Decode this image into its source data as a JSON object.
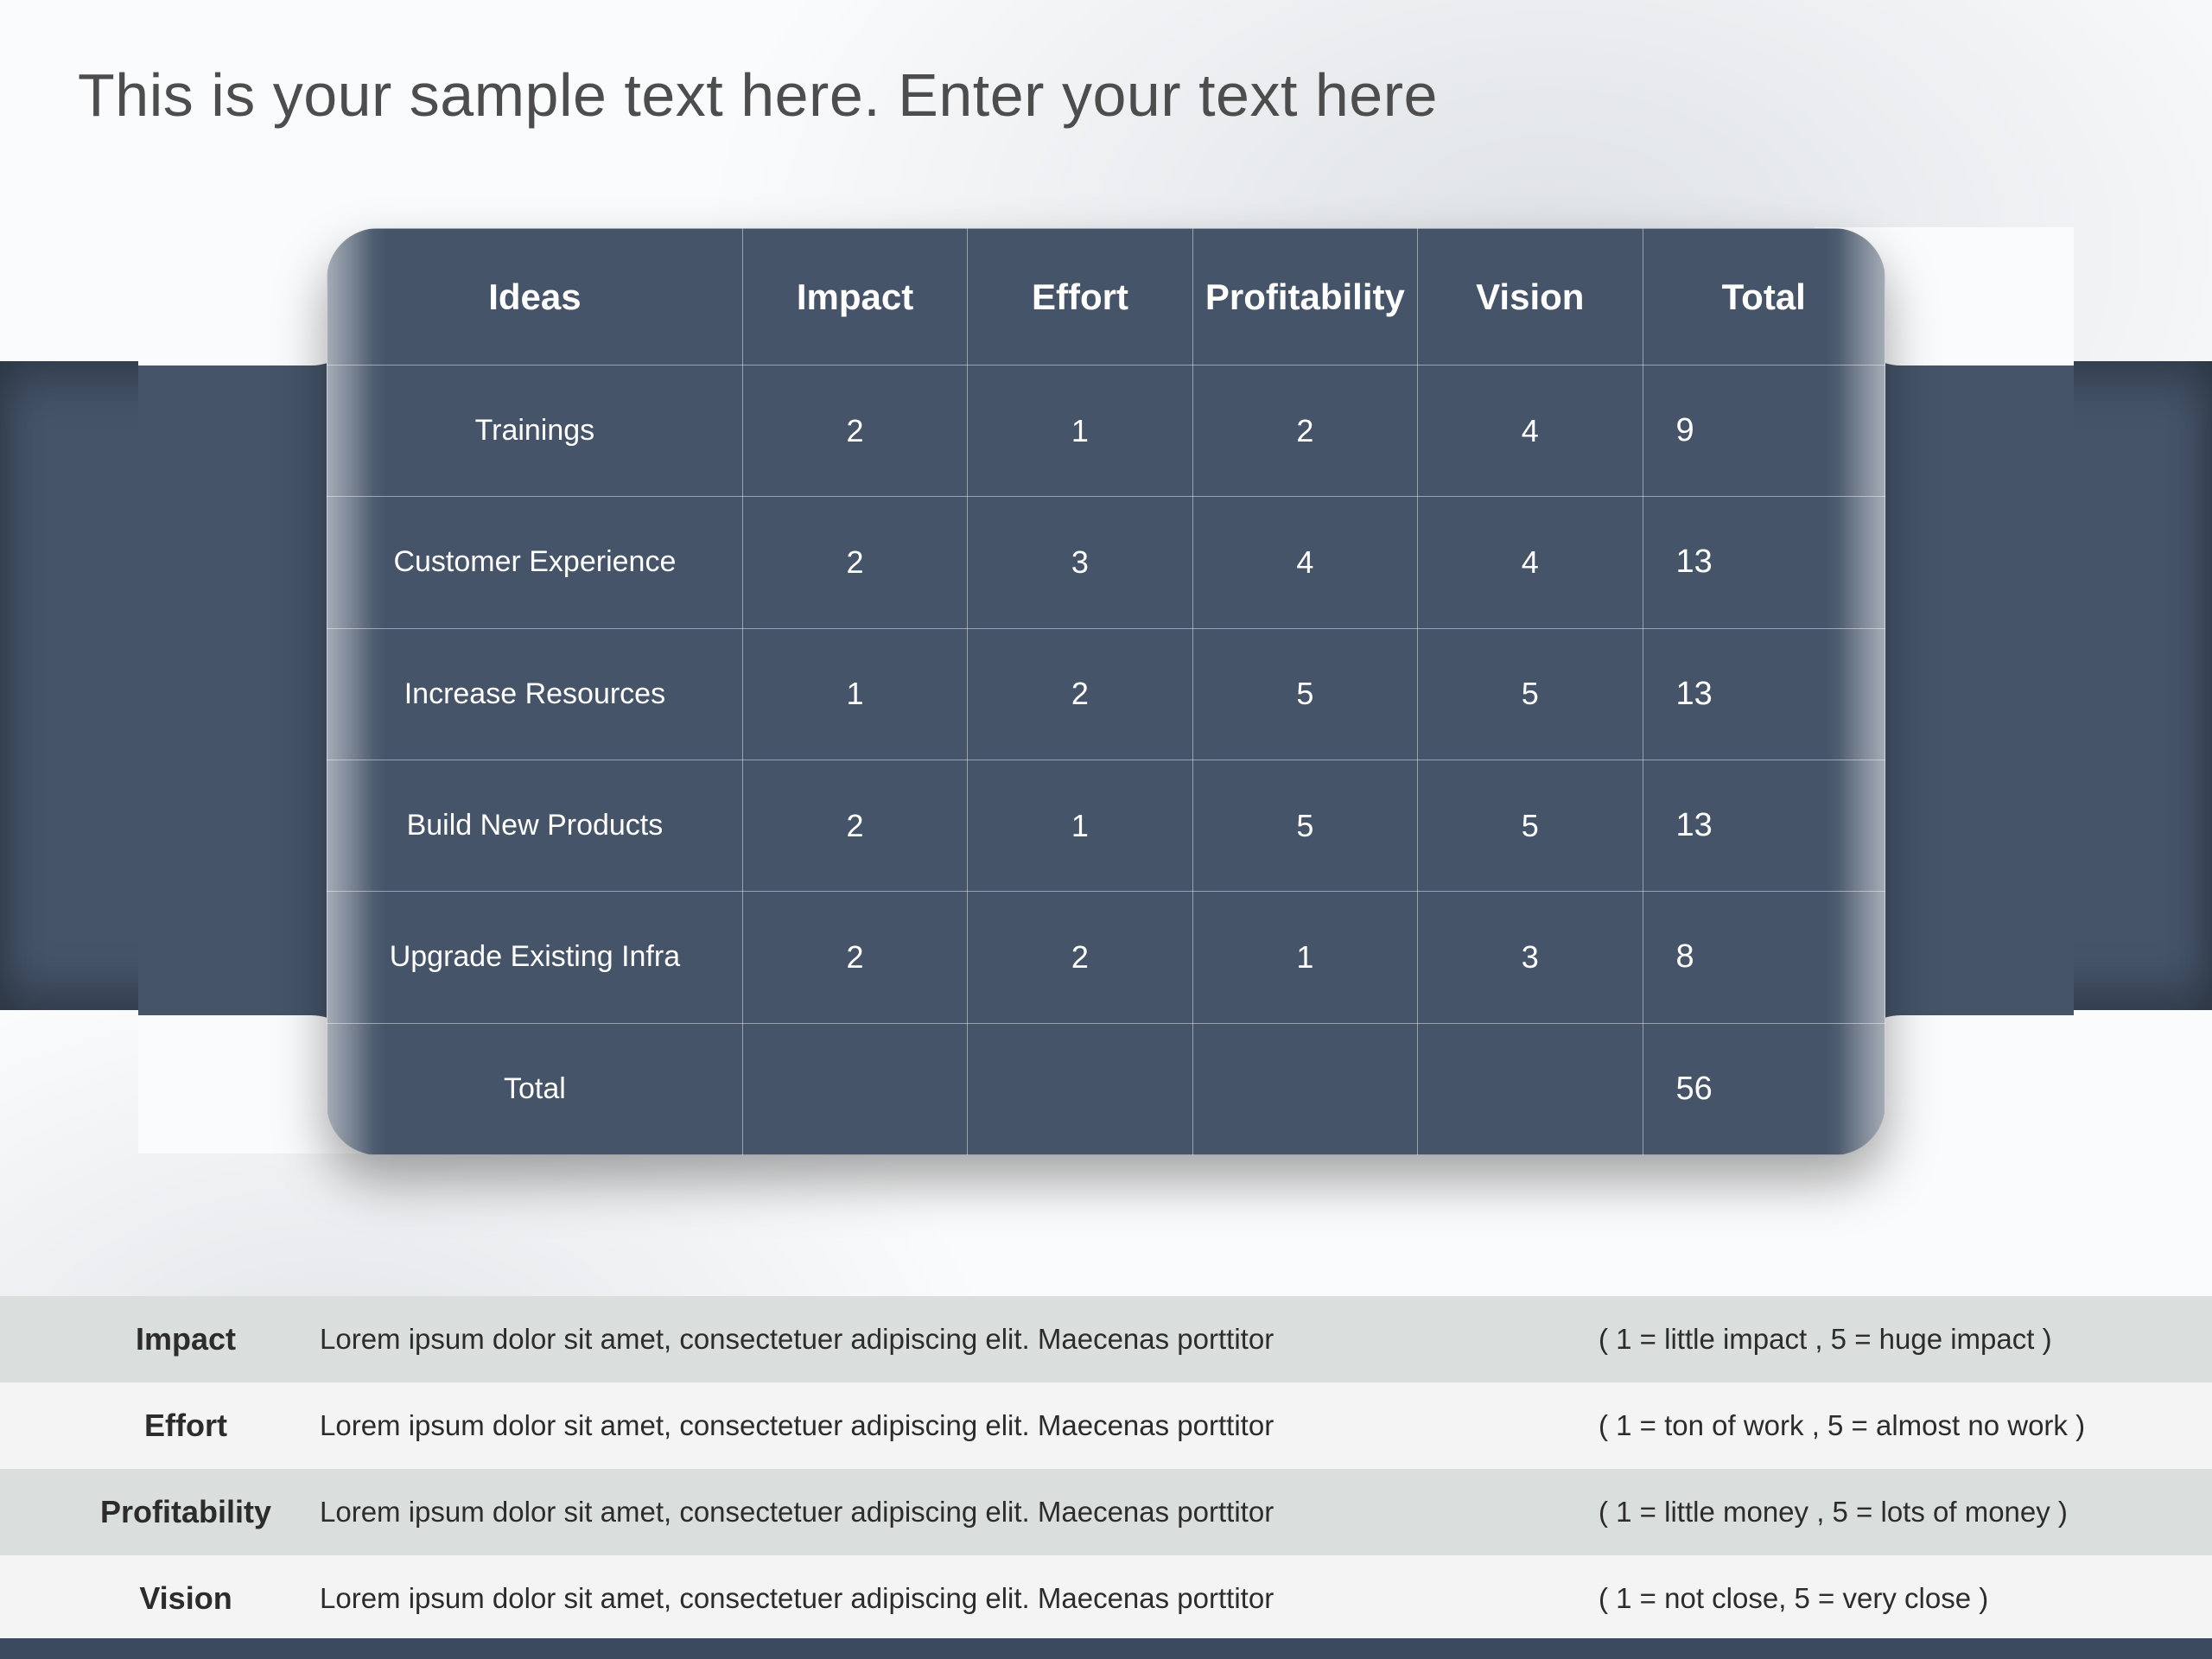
{
  "title": "This is your sample text here. Enter your text here",
  "table": {
    "headers": [
      "Ideas",
      "Impact",
      "Effort",
      "Profitability",
      "Vision",
      "Total"
    ],
    "rows": [
      {
        "idea": "Trainings",
        "impact": "2",
        "effort": "1",
        "profitability": "2",
        "vision": "4",
        "total": "9"
      },
      {
        "idea": "Customer Experience",
        "impact": "2",
        "effort": "3",
        "profitability": "4",
        "vision": "4",
        "total": "13"
      },
      {
        "idea": "Increase Resources",
        "impact": "1",
        "effort": "2",
        "profitability": "5",
        "vision": "5",
        "total": "13"
      },
      {
        "idea": "Build New Products",
        "impact": "2",
        "effort": "1",
        "profitability": "5",
        "vision": "5",
        "total": "13"
      },
      {
        "idea": "Upgrade Existing Infra",
        "impact": "2",
        "effort": "2",
        "profitability": "1",
        "vision": "3",
        "total": "8"
      }
    ],
    "footer": {
      "label": "Total",
      "total": "56"
    }
  },
  "legend": [
    {
      "label": "Impact",
      "desc": "Lorem ipsum dolor sit amet, consectetuer adipiscing elit. Maecenas porttitor",
      "scale": "( 1 = little impact , 5 = huge impact )"
    },
    {
      "label": "Effort",
      "desc": "Lorem ipsum dolor sit amet, consectetuer adipiscing elit. Maecenas porttitor",
      "scale": "( 1 = ton of work , 5 = almost no work )"
    },
    {
      "label": "Profitability",
      "desc": "Lorem ipsum dolor sit amet, consectetuer adipiscing elit. Maecenas porttitor",
      "scale": "( 1 = little money , 5 = lots of money )"
    },
    {
      "label": "Vision",
      "desc": "Lorem ipsum dolor sit amet, consectetuer adipiscing elit. Maecenas porttitor",
      "scale": "( 1 = not close, 5 = very close )"
    }
  ],
  "chart_data": {
    "type": "table",
    "title": "This is your sample text here. Enter your text here",
    "columns": [
      "Ideas",
      "Impact",
      "Effort",
      "Profitability",
      "Vision",
      "Total"
    ],
    "rows": [
      [
        "Trainings",
        2,
        1,
        2,
        4,
        9
      ],
      [
        "Customer Experience",
        2,
        3,
        4,
        4,
        13
      ],
      [
        "Increase Resources",
        1,
        2,
        5,
        5,
        13
      ],
      [
        "Build New Products",
        2,
        1,
        5,
        5,
        13
      ],
      [
        "Upgrade Existing Infra",
        2,
        2,
        1,
        3,
        8
      ]
    ],
    "grand_total": 56,
    "scales": {
      "Impact": {
        "1": "little impact",
        "5": "huge impact"
      },
      "Effort": {
        "1": "ton of work",
        "5": "almost no work"
      },
      "Profitability": {
        "1": "little money",
        "5": "lots of money"
      },
      "Vision": {
        "1": "not close",
        "5": "very close"
      }
    }
  }
}
